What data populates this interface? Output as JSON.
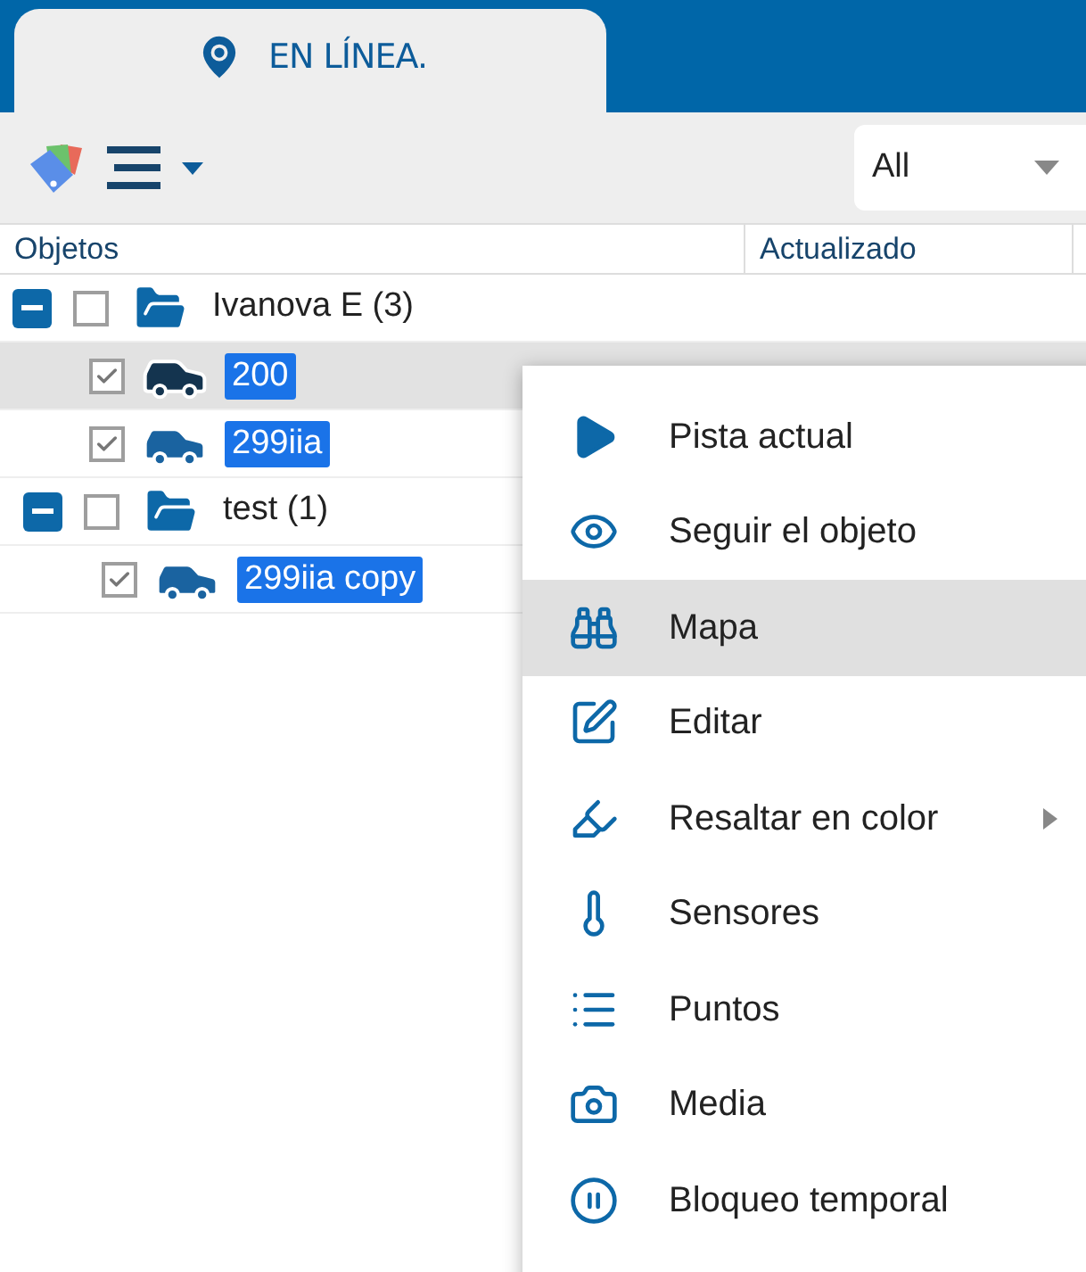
{
  "tab": {
    "label": "EN LÍNEA."
  },
  "filter": {
    "value": "All"
  },
  "table": {
    "columns": [
      "Objetos",
      "Actualizado"
    ]
  },
  "tree": [
    {
      "label": "Ivanova E (3)",
      "expanded": true,
      "checked": false,
      "children": [
        {
          "label": "200",
          "checked": true,
          "selected": true
        },
        {
          "label": "299iia",
          "checked": true,
          "selected": false
        }
      ]
    },
    {
      "label": "test (1)",
      "expanded": true,
      "checked": false,
      "children": [
        {
          "label": "299iia copy",
          "checked": true,
          "selected": false
        }
      ]
    }
  ],
  "context_menu": [
    {
      "kind": "play",
      "label": "Pista actual",
      "selected": false,
      "submenu": false
    },
    {
      "kind": "eye",
      "label": "Seguir el objeto",
      "selected": false,
      "submenu": false
    },
    {
      "kind": "binoculars",
      "label": "Mapa",
      "selected": true,
      "submenu": false
    },
    {
      "kind": "edit",
      "label": "Editar",
      "selected": false,
      "submenu": false
    },
    {
      "kind": "highlighter",
      "label": "Resaltar en color",
      "selected": false,
      "submenu": true
    },
    {
      "kind": "thermometer",
      "label": "Sensores",
      "selected": false,
      "submenu": false
    },
    {
      "kind": "list",
      "label": "Puntos",
      "selected": false,
      "submenu": false
    },
    {
      "kind": "camera",
      "label": "Media",
      "selected": false,
      "submenu": false
    },
    {
      "kind": "pause",
      "label": "Bloqueo temporal",
      "selected": false,
      "submenu": false
    }
  ]
}
